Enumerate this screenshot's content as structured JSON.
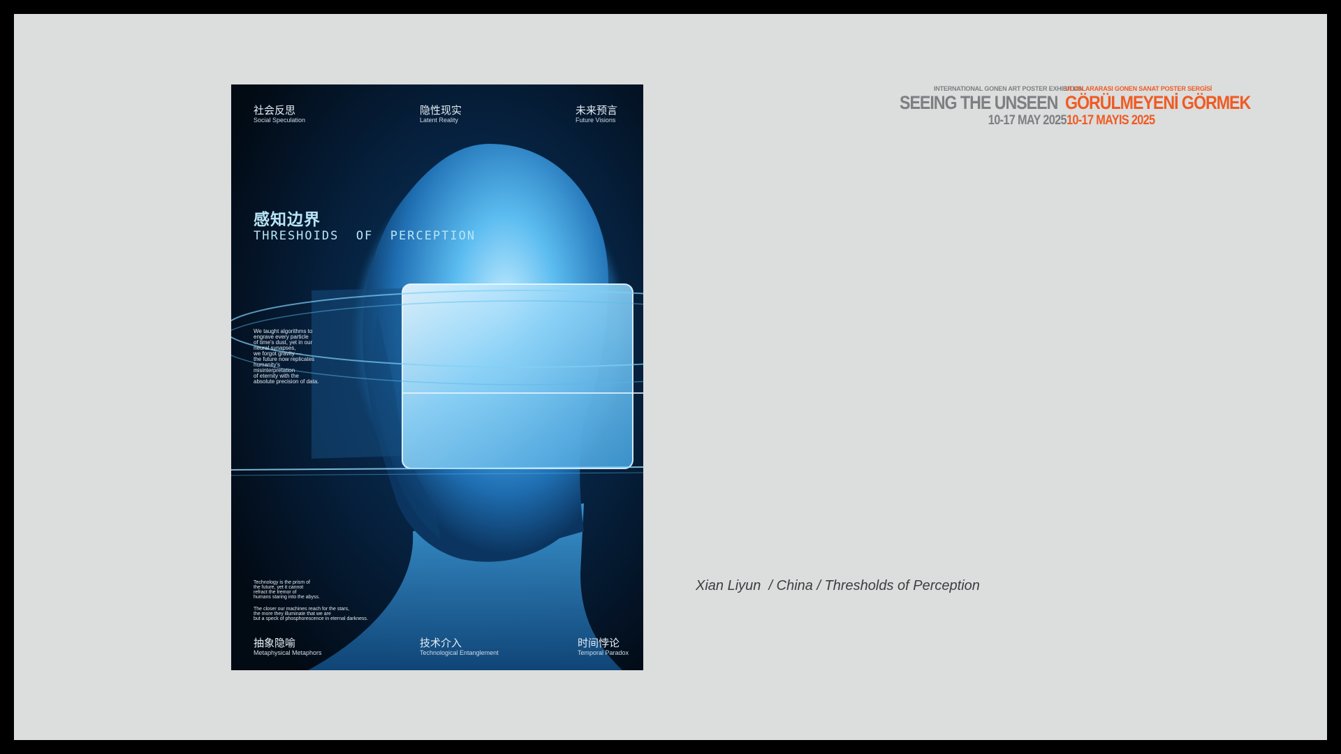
{
  "poster": {
    "categories": [
      {
        "zh": "社会反思",
        "en": "Social Speculation"
      },
      {
        "zh": "隐性现实",
        "en": "Latent Reality"
      },
      {
        "zh": "未来预言",
        "en": "Future Visions"
      },
      {
        "zh": "抽象隐喻",
        "en": "Metaphysical Metaphors"
      },
      {
        "zh": "技术介入",
        "en": "Technological Entanglement"
      },
      {
        "zh": "时间悖论",
        "en": "Temporal Paradox"
      }
    ],
    "title_zh": "感知边界",
    "title_en": "THRESHOIDS  OF  PERCEPTION",
    "text_block": "We taught algorithms to\nengrave every particle\nof time's dust, yet in our\nneural synapses,\nwe forgot gravity —\nthe future now replicates\nhumanity's\nmisinterpretation\nof eternity with the\nabsolute precision of data.",
    "quote_1": "Technology is the prism of\nthe future, yet it cannot\nrefract the tremor of\nhumans staring into the abyss.",
    "quote_2": "The closer our machines reach for the stars,\nthe more they illuminate that we are\nbut a speck of phosphorescence in eternal darkness."
  },
  "header": {
    "en_small": "INTERNATIONAL GONEN ART POSTER EXHIBITION",
    "en_title": "SEEING THE UNSEEN",
    "en_date": "10-17 MAY 2025",
    "tr_small": "ULUSLARARASI GONEN SANAT POSTER SERGİSİ",
    "tr_title": "GÖRÜLMEYENİ GÖRMEK",
    "tr_date": "10-17 MAYIS 2025"
  },
  "caption": "Xian Liyun  / China / Thresholds of Perception",
  "colors": {
    "slide_bg": "#dcdddd",
    "frame": "#000000",
    "accent_orange": "#ef5b23",
    "gray_text": "#7d7f82",
    "poster_glow": "#3fa9e6"
  }
}
